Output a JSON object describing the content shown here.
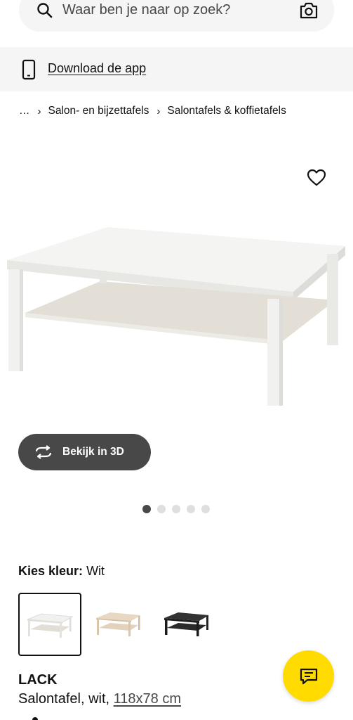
{
  "search": {
    "placeholder": "Waar ben je naar op zoek?"
  },
  "app_banner": {
    "label": "Download de app"
  },
  "breadcrumb": {
    "items": [
      "…",
      "Salon- en bijzettafels",
      "Salontafels & koffietafels"
    ]
  },
  "gallery": {
    "view3d_label": "Bekijk in 3D",
    "dots_total": 5,
    "active_index": 0
  },
  "color": {
    "title": "Kies kleur:",
    "selected": "Wit",
    "swatches": [
      "white",
      "white-stained-oak",
      "black-brown"
    ]
  },
  "product": {
    "name": "LACK",
    "description": "Salontafel, wit,",
    "dimensions": "118x78 cm"
  },
  "colors": {
    "accent": "#ffdb00",
    "dark": "#484848",
    "banner_bg": "#f5f5f5"
  }
}
